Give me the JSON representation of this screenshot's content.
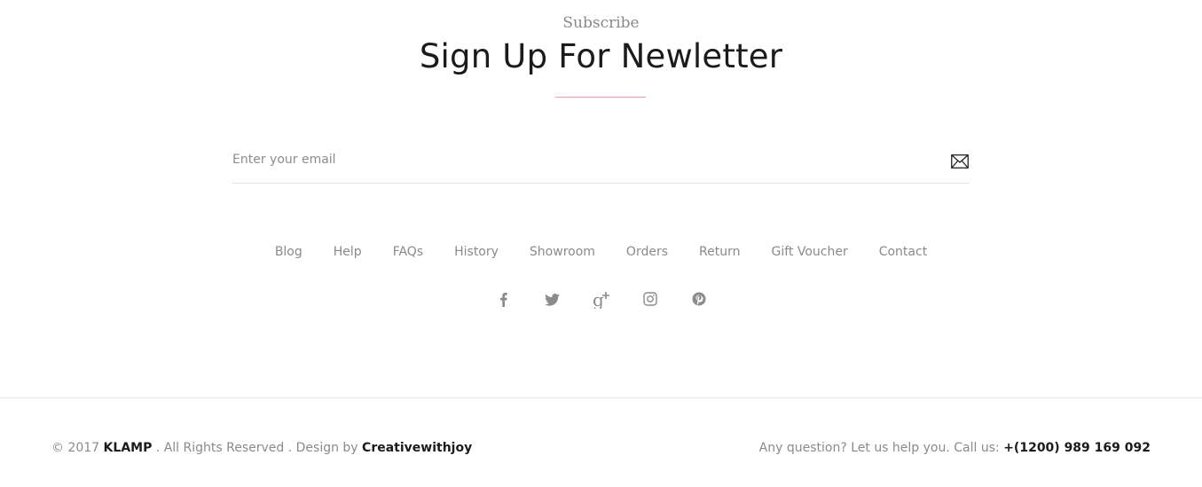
{
  "newsletter": {
    "kicker": "Subscribe",
    "heading": "Sign Up For Newletter",
    "email_placeholder": "Enter your email",
    "submit_icon": "envelope-icon",
    "accent_color": "#e3a3a3"
  },
  "nav_links": [
    "Blog",
    "Help",
    "FAQs",
    "History",
    "Showroom",
    "Orders",
    "Return",
    "Gift Voucher",
    "Contact"
  ],
  "social_icons": [
    "facebook-icon",
    "twitter-icon",
    "google-plus-icon",
    "instagram-icon",
    "pinterest-icon"
  ],
  "footer": {
    "copyright_prefix": "© 2017",
    "brand": "KLAMP",
    "rights_text": ". All Rights Reserved . Design by",
    "designer": "Creativewithjoy",
    "question_text": "Any question? Let us help you. Call us:",
    "phone": "+(1200) 989 169 092"
  }
}
